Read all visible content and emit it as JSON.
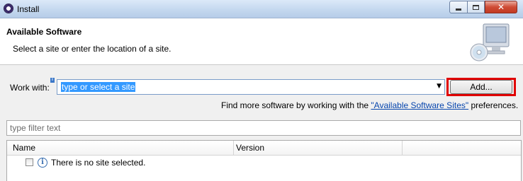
{
  "window": {
    "title": "Install",
    "controls": {
      "minimize_icon": "minimize-icon",
      "maximize_icon": "maximize-icon",
      "close_icon": "close-icon"
    }
  },
  "header": {
    "title": "Available Software",
    "description": "Select a site or enter the location of a site.",
    "banner_icon": "computer-cd-icon"
  },
  "work_with": {
    "label": "Work with:",
    "hint_badge": "i",
    "value": "type or select a site",
    "add_button": "Add...",
    "add_button_highlight_color": "#e00000"
  },
  "more_software": {
    "prefix": "Find more software by working with the ",
    "link": "\"Available Software Sites\"",
    "suffix": " preferences."
  },
  "filter": {
    "placeholder": "type filter text"
  },
  "table": {
    "columns": [
      "Name",
      "Version"
    ],
    "rows": [
      {
        "checked": false,
        "icon": "info-icon",
        "text": "There is no site selected."
      }
    ]
  }
}
